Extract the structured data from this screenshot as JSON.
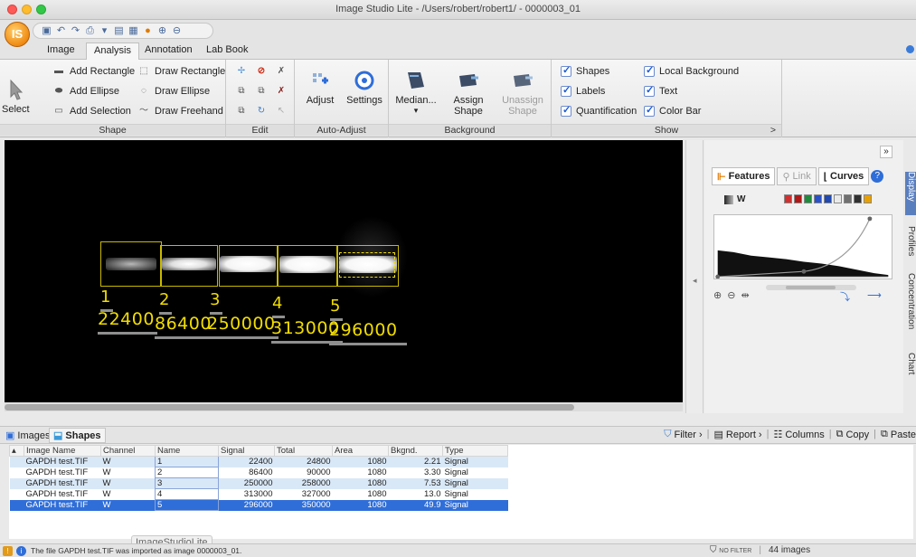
{
  "window": {
    "title": "Image Studio Lite - /Users/robert/robert1/ - 0000003_01"
  },
  "app_ball_label": "IS",
  "ribbon_tabs": [
    "Image",
    "Analysis",
    "Annotation",
    "Lab Book"
  ],
  "active_tab": "Analysis",
  "ribbon": {
    "shape": {
      "select_label": "Select",
      "add_rectangle": "Add Rectangle",
      "add_ellipse": "Add Ellipse",
      "add_selection": "Add Selection",
      "draw_rectangle": "Draw Rectangle",
      "draw_ellipse": "Draw Ellipse",
      "draw_freehand": "Draw Freehand",
      "group_label": "Shape"
    },
    "edit": {
      "group_label": "Edit"
    },
    "auto_adjust": {
      "adjust": "Adjust",
      "settings": "Settings",
      "group_label": "Auto-Adjust"
    },
    "background": {
      "median": "Median...",
      "assign_shape_l1": "Assign",
      "assign_shape_l2": "Shape",
      "unassign_shape_l1": "Unassign",
      "unassign_shape_l2": "Shape",
      "group_label": "Background"
    },
    "show": {
      "shapes": "Shapes",
      "labels": "Labels",
      "quantification": "Quantification",
      "local_background": "Local Background",
      "text": "Text",
      "color_bar": "Color Bar",
      "group_label": "Show",
      "expander": ">"
    }
  },
  "lanes": [
    {
      "number": "1",
      "value": "22400"
    },
    {
      "number": "2",
      "value": "86400"
    },
    {
      "number": "3",
      "value": "250000"
    },
    {
      "number": "4",
      "value": "313000"
    },
    {
      "number": "5",
      "value": "296000"
    }
  ],
  "right_panel": {
    "collapse": "»",
    "tabs": {
      "features": "Features",
      "link": "Link",
      "curves": "Curves"
    },
    "channel": "W",
    "side_tabs": [
      "Display",
      "Profiles",
      "Concentration",
      "Chart"
    ],
    "swatches": [
      "#d03030",
      "#b01818",
      "#208a3c",
      "#2a52c8",
      "#2048b0",
      "#eaeaea",
      "#707070",
      "#303030",
      "#e8a000"
    ]
  },
  "bottom": {
    "tabs": {
      "images": "Images",
      "shapes": "Shapes"
    },
    "toolbar": {
      "filter": "Filter",
      "report": "Report",
      "columns": "Columns",
      "copy": "Copy",
      "paste": "Paste"
    },
    "columns": [
      "Image Name",
      "Channel",
      "Name",
      "Signal",
      "Total",
      "Area",
      "Bkgnd.",
      "Type"
    ],
    "rows": [
      [
        "GAPDH test.TIF",
        "W",
        "1",
        "22400",
        "24800",
        "1080",
        "2.21",
        "Signal"
      ],
      [
        "GAPDH test.TIF",
        "W",
        "2",
        "86400",
        "90000",
        "1080",
        "3.30",
        "Signal"
      ],
      [
        "GAPDH test.TIF",
        "W",
        "3",
        "250000",
        "258000",
        "1080",
        "7.53",
        "Signal"
      ],
      [
        "GAPDH test.TIF",
        "W",
        "4",
        "313000",
        "327000",
        "1080",
        "13.0",
        "Signal"
      ],
      [
        "GAPDH test.TIF",
        "W",
        "5",
        "296000",
        "350000",
        "1080",
        "49.9",
        "Signal"
      ]
    ],
    "selected_row": 4
  },
  "watermark": "ImageStudioLite",
  "status": {
    "message": "The file GAPDH test.TIF was imported as image 0000003_01.",
    "filter": "NO FILTER",
    "count": "44 images"
  }
}
